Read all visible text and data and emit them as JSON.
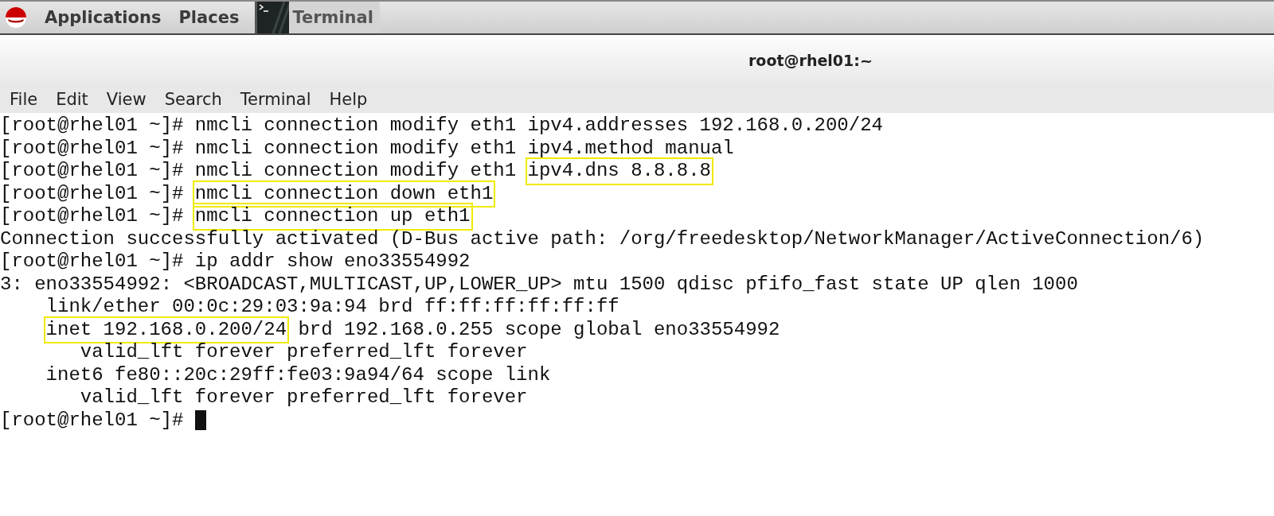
{
  "top_panel": {
    "menus": [
      "Applications",
      "Places"
    ],
    "taskbar": [
      {
        "label": "Terminal",
        "selected": true
      }
    ]
  },
  "window": {
    "title": "root@rhel01:~"
  },
  "menu_bar": [
    "File",
    "Edit",
    "View",
    "Search",
    "Terminal",
    "Help"
  ],
  "terminal": {
    "lines": [
      {
        "segments": [
          {
            "text": "[root@rhel01 ~]# nmcli connection modify eth1 ipv4.addresses 192.168.0.200/24",
            "highlighted": false
          }
        ]
      },
      {
        "segments": [
          {
            "text": "[root@rhel01 ~]# nmcli connection modify eth1 ipv4.method manual",
            "highlighted": false
          }
        ]
      },
      {
        "segments": [
          {
            "text": "[root@rhel01 ~]# nmcli connection modify eth1 ",
            "highlighted": false
          },
          {
            "text": "ipv4.dns 8.8.8.8",
            "highlighted": true
          }
        ]
      },
      {
        "segments": [
          {
            "text": "[root@rhel01 ~]# ",
            "highlighted": false
          },
          {
            "text": "nmcli connection down eth1",
            "highlighted": true
          }
        ]
      },
      {
        "segments": [
          {
            "text": "[root@rhel01 ~]# ",
            "highlighted": false
          },
          {
            "text": "nmcli connection up eth1",
            "highlighted": true
          }
        ]
      },
      {
        "segments": [
          {
            "text": "Connection successfully activated (D-Bus active path: /org/freedesktop/NetworkManager/ActiveConnection/6)",
            "highlighted": false
          }
        ]
      },
      {
        "segments": [
          {
            "text": "[root@rhel01 ~]# ip addr show eno33554992",
            "highlighted": false
          }
        ]
      },
      {
        "segments": [
          {
            "text": "3: eno33554992: <BROADCAST,MULTICAST,UP,LOWER_UP> mtu 1500 qdisc pfifo_fast state UP qlen 1000",
            "highlighted": false
          }
        ]
      },
      {
        "segments": [
          {
            "text": "    link/ether 00:0c:29:03:9a:94 brd ff:ff:ff:ff:ff:ff",
            "highlighted": false
          }
        ]
      },
      {
        "indented": true,
        "segments": [
          {
            "text": "inet 192.168.0.200/24",
            "highlighted": true
          },
          {
            "text": " brd 192.168.0.255 scope global eno33554992",
            "highlighted": false
          }
        ]
      },
      {
        "segments": [
          {
            "text": "       valid_lft forever preferred_lft forever",
            "highlighted": false
          }
        ]
      },
      {
        "segments": [
          {
            "text": "    inet6 fe80::20c:29ff:fe03:9a94/64 scope link",
            "highlighted": false
          }
        ]
      },
      {
        "segments": [
          {
            "text": "       valid_lft forever preferred_lft forever",
            "highlighted": false
          }
        ]
      },
      {
        "segments": [
          {
            "text": "[root@rhel01 ~]# ",
            "highlighted": false
          }
        ],
        "cursor": true
      }
    ]
  }
}
